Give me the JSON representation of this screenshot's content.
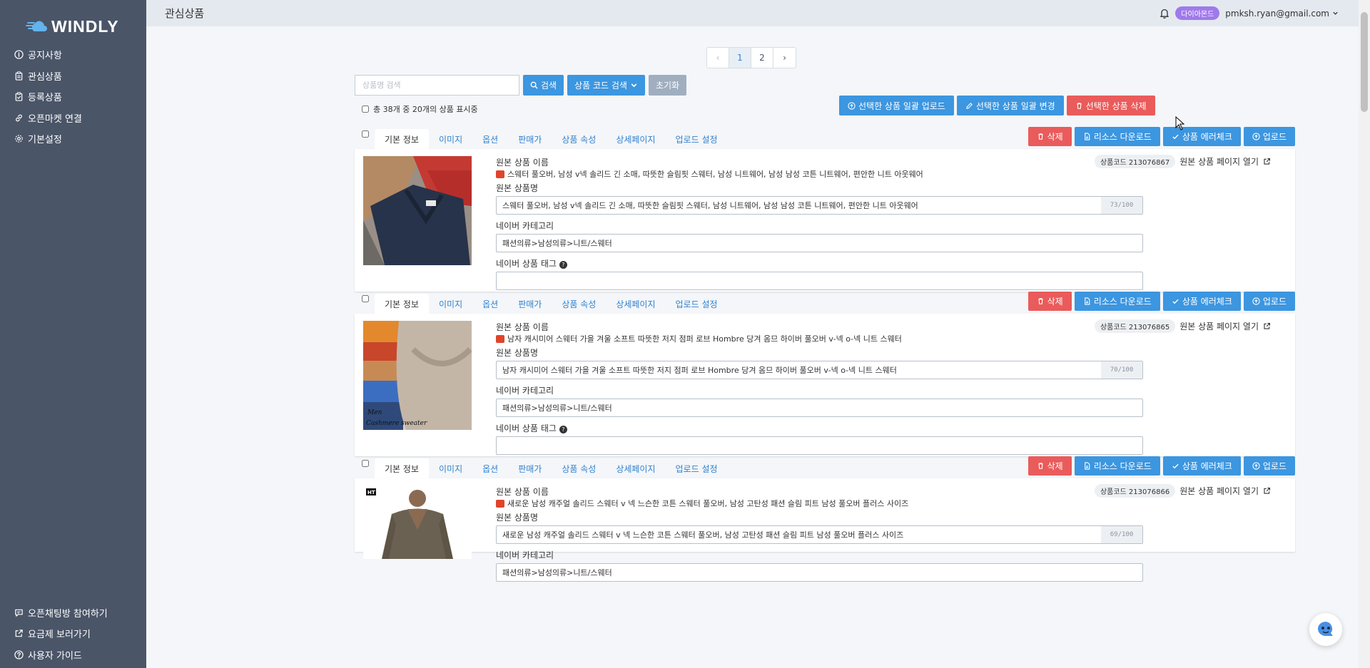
{
  "brand": {
    "name": "WINDLY"
  },
  "sidebar": {
    "items": [
      {
        "label": "공지사항",
        "icon": "info-icon"
      },
      {
        "label": "관심상품",
        "icon": "clipboard-icon"
      },
      {
        "label": "등록상품",
        "icon": "clipboard-check-icon"
      },
      {
        "label": "오픈마켓 연결",
        "icon": "link-icon"
      },
      {
        "label": "기본설정",
        "icon": "gear-icon"
      }
    ],
    "bottom_items": [
      {
        "label": "오픈채팅방 참여하기",
        "icon": "chat-icon"
      },
      {
        "label": "요금제 보러가기",
        "icon": "external-link-icon"
      },
      {
        "label": "사용자 가이드",
        "icon": "question-icon"
      }
    ]
  },
  "header": {
    "title": "관심상품",
    "badge": "다이아몬드",
    "email": "pmksh.ryan@gmail.com"
  },
  "pagination": {
    "prev": "‹",
    "pages": [
      "1",
      "2"
    ],
    "current": "1",
    "next": "›"
  },
  "search": {
    "placeholder": "상품명 검색",
    "search_label": "검색",
    "code_search_label": "상품 코드 검색",
    "reset_label": "초기화"
  },
  "summary": "총 38개 중 20개의 상품 표시중",
  "bulk_actions": {
    "upload": "선택한 상품 일괄 업로드",
    "edit": "선택한 상품 일괄 변경",
    "delete": "선택한 상품 삭제"
  },
  "card_tabs": [
    "기본 정보",
    "이미지",
    "옵션",
    "판매가",
    "상품 속성",
    "상세페이지",
    "업로드 설정"
  ],
  "card_actions": {
    "delete": "삭제",
    "resource": "리소스 다운로드",
    "error_check": "상품 에러체크",
    "upload": "업로드"
  },
  "field_labels": {
    "original_name": "원본 상품 이름",
    "product_name": "원본 상품명",
    "category": "네이버 카테고리",
    "tags": "네이버 상품 태그",
    "open_original": "원본 상품 페이지 열기"
  },
  "products": [
    {
      "code": "상품코드 213076867",
      "original_name": "스웨터 풀오버, 남성 v넥 솔리드 긴 소매, 따뜻한 슬림핏 스웨터, 남성 니트웨어, 남성 남성 코튼 니트웨어, 편안한 니트 아웃웨어",
      "name": "스웨터 풀오버, 남성 v넥 솔리드 긴 소매, 따뜻한 슬림핏 스웨터, 남성 니트웨어, 남성 남성 코튼 니트웨어, 편안한 니트 아웃웨어",
      "counter": "73/100",
      "category": "패션의류>남성의류>니트/스웨터",
      "tags": ""
    },
    {
      "code": "상품코드 213076865",
      "original_name": "남자 캐시미어 스웨터 가을 겨울 소프트 따뜻한 저지 점퍼 로브 Hombre 당겨 옴므 하이버 풀오버 v-넥 o-넥 니트 스웨터",
      "name": "남자 캐시미어 스웨터 가을 겨울 소프트 따뜻한 저지 점퍼 로브 Hombre 당겨 옴므 하이버 풀오버 v-넥 o-넥 니트 스웨터",
      "counter": "70/100",
      "category": "패션의류>남성의류>니트/스웨터",
      "tags": "",
      "image_caption_1": "Men",
      "image_caption_2": "Cashmere sweater"
    },
    {
      "code": "상품코드 213076866",
      "original_name": "새로운 남성 캐주얼 솔리드 스웨터 v 넥 느슨한 코튼 스웨터 풀오버, 남성 고탄성 패션 슬림 피트 남성 풀오버 플러스 사이즈",
      "name": "새로운 남성 캐주얼 솔리드 스웨터 v 넥 느슨한 코튼 스웨터 풀오버, 남성 고탄성 패션 슬림 피트 남성 풀오버 플러스 사이즈",
      "counter": "69/100",
      "category": "패션의류>남성의류>니트/스웨터",
      "image_logo": "HT"
    }
  ],
  "colors": {
    "sidebar": "#4a5568",
    "primary": "#3c96e0",
    "danger": "#ea5b5b",
    "badge": "#9f7aea"
  }
}
